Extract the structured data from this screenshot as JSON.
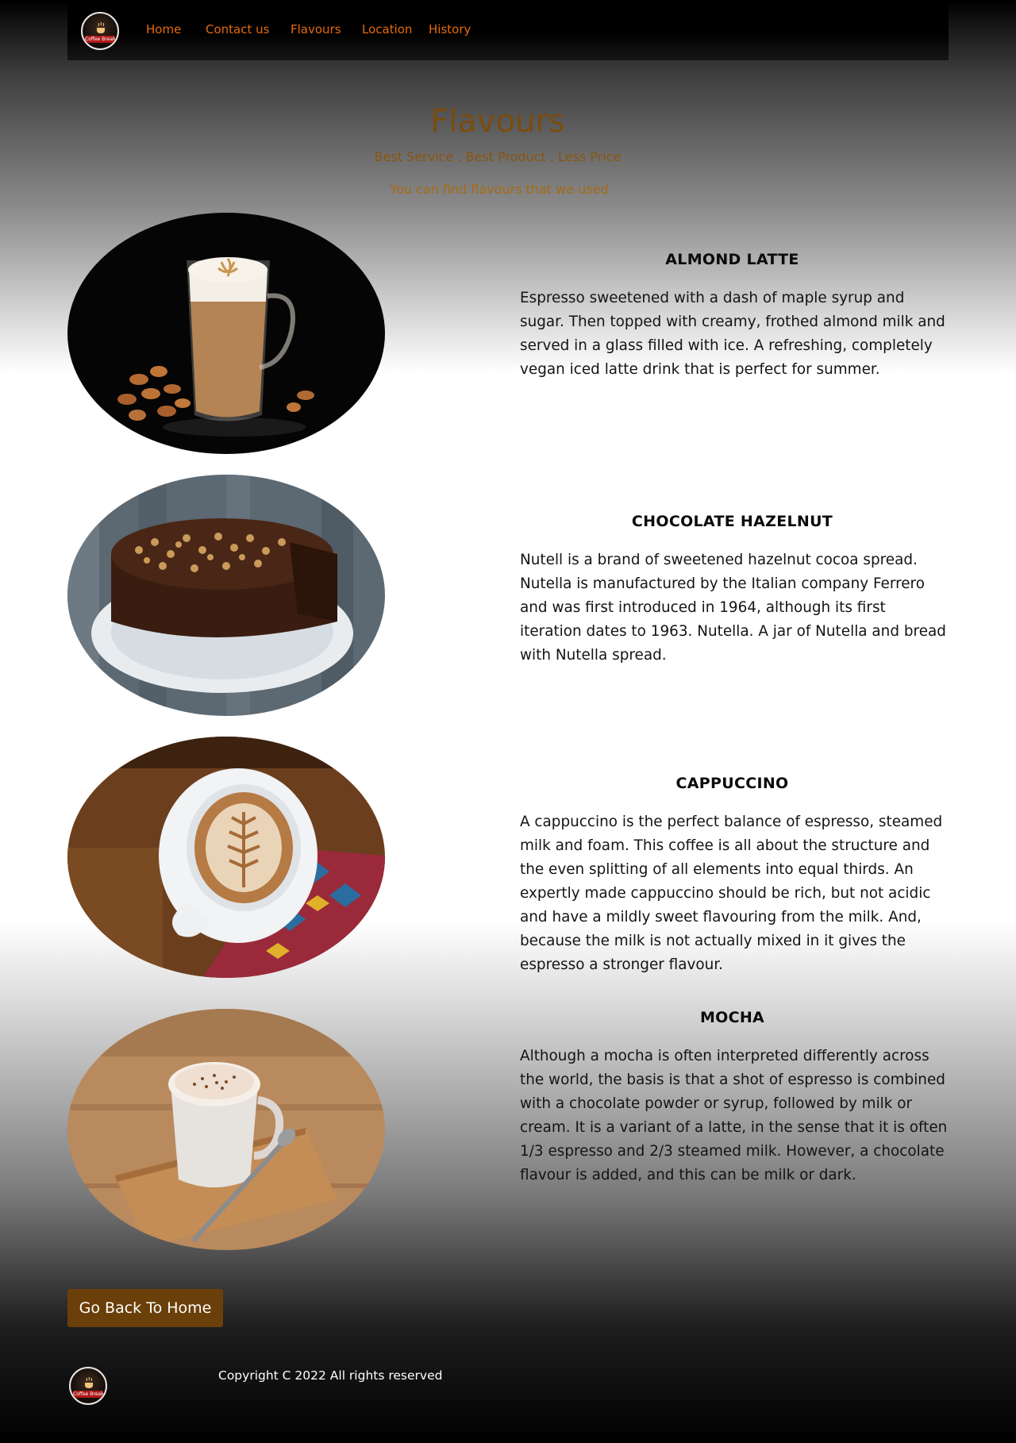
{
  "nav": {
    "logo_text": "Coffee Break",
    "links": [
      "Home",
      "Contact us",
      "Flavours",
      "Location",
      "History"
    ]
  },
  "hero": {
    "title": "Flavours",
    "tagline": "Best Service , Best Product , Less Price",
    "intro": "You can find flavours that we used"
  },
  "flavours": [
    {
      "title": "ALMOND LATTE",
      "description": "Espresso sweetened with a dash of maple syrup and sugar. Then topped with creamy, frothed almond milk and served in a glass filled with ice. A refreshing, completely vegan iced latte drink that is perfect for summer.",
      "image": "almond-latte-photo"
    },
    {
      "title": "CHOCOLATE HAZELNUT",
      "description": "Nutell is a brand of sweetened hazelnut cocoa spread. Nutella is manufactured by the Italian company Ferrero and was first introduced in 1964, although its first iteration dates to 1963. Nutella. A jar of Nutella and bread with Nutella spread.",
      "image": "chocolate-hazelnut-cake-photo"
    },
    {
      "title": "CAPPUCCINO",
      "description": "A cappuccino is the perfect balance of espresso, steamed milk and foam. This coffee is all about the structure and the even splitting of all elements into equal thirds. An expertly made cappuccino should be rich, but not acidic and have a mildly sweet flavouring from the milk. And, because the milk is not actually mixed in it gives the espresso a stronger flavour.",
      "image": "cappuccino-photo"
    },
    {
      "title": "MOCHA",
      "description": "Although a mocha is often interpreted differently across the world, the basis is that a shot of espresso is combined with a chocolate powder or syrup, followed by milk or cream. It is a variant of a latte, in the sense that it is often 1/3 espresso and 2/3 steamed milk. However, a chocolate flavour is added, and this can be milk or dark.",
      "image": "mocha-photo"
    }
  ],
  "home_button": {
    "label": "Go Back To Home"
  },
  "footer": {
    "logo_text": "Coffee Break",
    "copyright": "Copyright C 2022 All rights reserved"
  },
  "colors": {
    "nav_link": "#e56a10",
    "button_bg": "#6b3f0a",
    "title_brown": "#7a4c10"
  }
}
